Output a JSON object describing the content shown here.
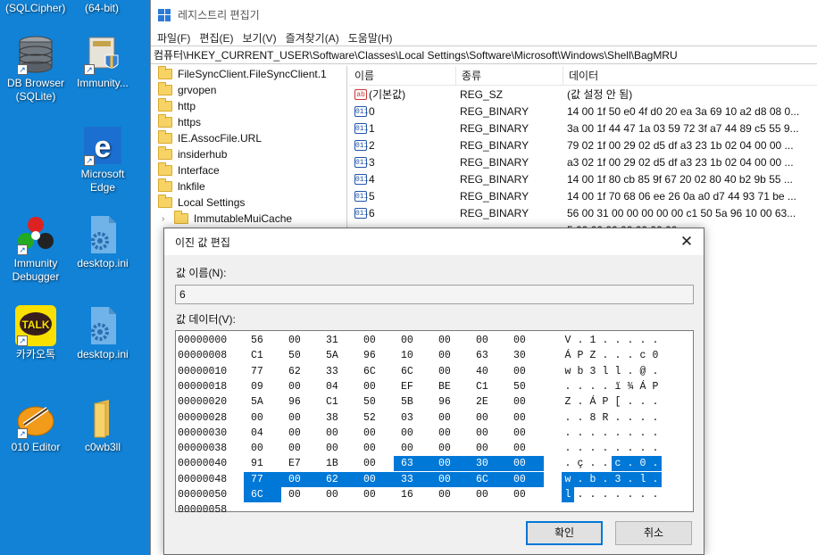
{
  "desktop": {
    "top_labels": [
      "(SQLCipher)",
      "(64-bit)"
    ],
    "icons": [
      {
        "label": "DB Browser (SQLite)"
      },
      {
        "label": "Immunity..."
      },
      {
        "label": "Microsoft Edge"
      },
      {
        "label": "Immunity Debugger"
      },
      {
        "label": "desktop.ini"
      },
      {
        "label": "카카오톡"
      },
      {
        "label": "desktop.ini"
      },
      {
        "label": "010 Editor"
      },
      {
        "label": "c0wb3ll"
      }
    ]
  },
  "regedit": {
    "title": "레지스트리 편집기",
    "menu": [
      "파일(F)",
      "편집(E)",
      "보기(V)",
      "즐겨찾기(A)",
      "도움말(H)"
    ],
    "address": "컴퓨터\\HKEY_CURRENT_USER\\Software\\Classes\\Local Settings\\Software\\Microsoft\\Windows\\Shell\\BagMRU",
    "tree": [
      {
        "label": "FileSyncClient.FileSyncClient.1"
      },
      {
        "label": "grvopen"
      },
      {
        "label": "http"
      },
      {
        "label": "https"
      },
      {
        "label": "IE.AssocFile.URL"
      },
      {
        "label": "insiderhub"
      },
      {
        "label": "Interface"
      },
      {
        "label": "lnkfile"
      },
      {
        "label": "Local Settings"
      },
      {
        "label": "ImmutableMuiCache"
      }
    ],
    "columns": [
      "이름",
      "종류",
      "데이터"
    ],
    "values": [
      {
        "name": "(기본값)",
        "type": "REG_SZ",
        "data": "(값 설정 안 됨)",
        "icon": "ab"
      },
      {
        "name": "0",
        "type": "REG_BINARY",
        "data": "14 00 1f 50 e0 4f d0 20 ea 3a 69 10 a2 d8 08 0...",
        "icon": "bin"
      },
      {
        "name": "1",
        "type": "REG_BINARY",
        "data": "3a 00 1f 44 47 1a 03 59 72 3f a7 44 89 c5 55 9...",
        "icon": "bin"
      },
      {
        "name": "2",
        "type": "REG_BINARY",
        "data": "79 02 1f 00 29 02 d5 df a3 23 1b 02 04 00 00 ...",
        "icon": "bin"
      },
      {
        "name": "3",
        "type": "REG_BINARY",
        "data": "a3 02 1f 00 29 02 d5 df a3 23 1b 02 04 00 00 ...",
        "icon": "bin"
      },
      {
        "name": "4",
        "type": "REG_BINARY",
        "data": "14 00 1f 80 cb 85 9f 67 20 02 80 40 b2 9b 55 ...",
        "icon": "bin"
      },
      {
        "name": "5",
        "type": "REG_BINARY",
        "data": "14 00 1f 70 68 06 ee 26 0a a0 d7 44 93 71 be ...",
        "icon": "bin"
      },
      {
        "name": "6",
        "type": "REG_BINARY",
        "data": "56 00 31 00 00 00 00 00 c1 50 5a 96 10 00 63...",
        "icon": "bin"
      },
      {
        "name": "",
        "type": "",
        "data": "5 00 00 00 00 00 00 00...",
        "icon": ""
      },
      {
        "name": "",
        "type": "",
        "data": "2 02 02 02 02 02 02 0...",
        "icon": ""
      }
    ]
  },
  "dialog": {
    "title": "이진 값 편집",
    "close": "✕",
    "name_label": "값 이름(N):",
    "name_value": "6",
    "data_label": "값 데이터(V):",
    "hex_rows": [
      {
        "offset": "00000000",
        "bytes": [
          "56",
          "00",
          "31",
          "00",
          "00",
          "00",
          "00",
          "00"
        ],
        "ascii": [
          "V",
          ".",
          "1",
          ".",
          ".",
          ".",
          ".",
          "."
        ]
      },
      {
        "offset": "00000008",
        "bytes": [
          "C1",
          "50",
          "5A",
          "96",
          "10",
          "00",
          "63",
          "30"
        ],
        "ascii": [
          "Á",
          "P",
          "Z",
          ".",
          ".",
          ".",
          "c",
          "0"
        ]
      },
      {
        "offset": "00000010",
        "bytes": [
          "77",
          "62",
          "33",
          "6C",
          "6C",
          "00",
          "40",
          "00"
        ],
        "ascii": [
          "w",
          "b",
          "3",
          "l",
          "l",
          ".",
          "@",
          "."
        ]
      },
      {
        "offset": "00000018",
        "bytes": [
          "09",
          "00",
          "04",
          "00",
          "EF",
          "BE",
          "C1",
          "50"
        ],
        "ascii": [
          ".",
          ".",
          ".",
          ".",
          "ï",
          "¾",
          "Á",
          "P"
        ]
      },
      {
        "offset": "00000020",
        "bytes": [
          "5A",
          "96",
          "C1",
          "50",
          "5B",
          "96",
          "2E",
          "00"
        ],
        "ascii": [
          "Z",
          ".",
          "Á",
          "P",
          "[",
          ".",
          ".",
          "."
        ]
      },
      {
        "offset": "00000028",
        "bytes": [
          "00",
          "00",
          "38",
          "52",
          "03",
          "00",
          "00",
          "00"
        ],
        "ascii": [
          ".",
          ".",
          "8",
          "R",
          ".",
          ".",
          ".",
          "."
        ]
      },
      {
        "offset": "00000030",
        "bytes": [
          "04",
          "00",
          "00",
          "00",
          "00",
          "00",
          "00",
          "00"
        ],
        "ascii": [
          ".",
          ".",
          ".",
          ".",
          ".",
          ".",
          ".",
          "."
        ]
      },
      {
        "offset": "00000038",
        "bytes": [
          "00",
          "00",
          "00",
          "00",
          "00",
          "00",
          "00",
          "00"
        ],
        "ascii": [
          ".",
          ".",
          ".",
          ".",
          ".",
          ".",
          ".",
          "."
        ]
      },
      {
        "offset": "00000040",
        "bytes": [
          "91",
          "E7",
          "1B",
          "00",
          "63",
          "00",
          "30",
          "00"
        ],
        "ascii": [
          ".",
          "ç",
          ".",
          ".",
          "c",
          ".",
          "0",
          "."
        ],
        "sel_from": 4
      },
      {
        "offset": "00000048",
        "bytes": [
          "77",
          "00",
          "62",
          "00",
          "33",
          "00",
          "6C",
          "00"
        ],
        "ascii": [
          "w",
          ".",
          "b",
          ".",
          "3",
          ".",
          "l",
          "."
        ],
        "sel_from": 0
      },
      {
        "offset": "00000050",
        "bytes": [
          "6C",
          "00",
          "00",
          "00",
          "16",
          "00",
          "00",
          "00"
        ],
        "ascii": [
          "l",
          ".",
          ".",
          ".",
          ".",
          ".",
          ".",
          "."
        ],
        "sel_from": 0,
        "sel_to": 0
      },
      {
        "offset": "00000058",
        "bytes": [],
        "ascii": []
      }
    ],
    "ok": "확인",
    "cancel": "취소"
  },
  "colors": {
    "desktop_bg": "#1182d6",
    "selection": "#0078d7"
  }
}
